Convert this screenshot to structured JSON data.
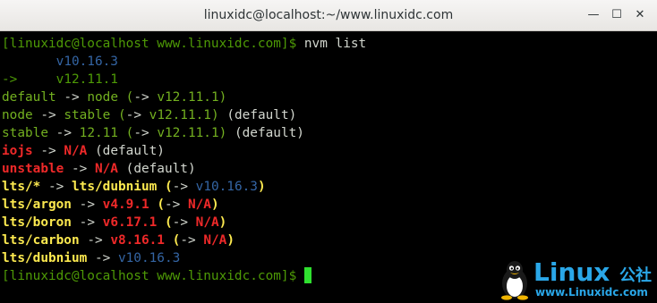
{
  "window": {
    "title": "linuxidc@localhost:~/www.linuxidc.com",
    "minimize_glyph": "—",
    "maximize_glyph": "☐",
    "close_glyph": "✕"
  },
  "terminal": {
    "prompt": "[linuxidc@localhost www.linuxidc.com]$",
    "command": " nvm list",
    "arrow": "->",
    "open_paren": "(",
    "close_paren": ")",
    "na": "N/A",
    "default_tag": "(default)",
    "installed": [
      "v10.16.3",
      "v12.11.1"
    ],
    "aliases": {
      "default": "default",
      "node": "node",
      "stable": "stable",
      "iojs": "iojs",
      "unstable": "unstable",
      "lts_star": "lts/*",
      "lts_dubnium": "lts/dubnium",
      "lts_argon": "lts/argon",
      "lts_boron": "lts/boron",
      "lts_carbon": "lts/carbon",
      "v12_11": "12.11"
    },
    "versions": {
      "v10_16_3": "v10.16.3",
      "v12_11_1": "v12.11.1",
      "v4_9_1": "v4.9.1",
      "v6_17_1": "v6.17.1",
      "v8_16_1": "v8.16.1"
    }
  },
  "watermark": {
    "word": "Linux",
    "chinese": "公社",
    "url": "www.Linuxidc.com"
  },
  "colors": {
    "prompt_green": "#4e9a06",
    "cursor_green": "#2fe02f",
    "version_blue": "#3465a4",
    "na_red": "#ef2929",
    "lts_yellow": "#fce94f",
    "watermark_blue": "#2aa7e8"
  }
}
